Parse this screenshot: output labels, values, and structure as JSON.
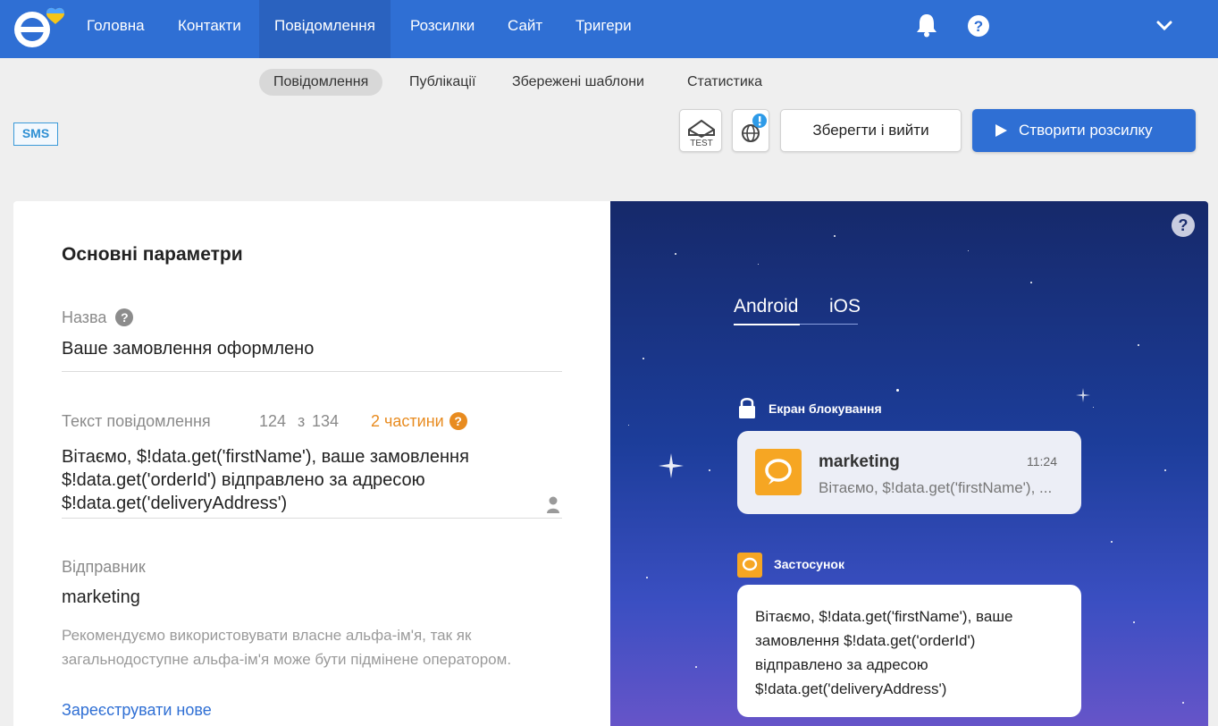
{
  "nav": {
    "items": [
      "Головна",
      "Контакти",
      "Повідомлення",
      "Розсилки",
      "Сайт",
      "Тригери"
    ],
    "active_index": 2
  },
  "subnav": {
    "tabs": [
      "Повідомлення",
      "Публікації",
      "Збережені шаблони",
      "Статистика"
    ],
    "active_index": 0
  },
  "channel_badge": "SMS",
  "toolbar": {
    "test_label": "TEST",
    "save_label": "Зберегти і вийти",
    "create_label": "Створити розсилку"
  },
  "form": {
    "title": "Основні параметри",
    "name_label": "Назва",
    "name_value": "Ваше замовлення оформлено",
    "text_label": "Текст повідомлення",
    "char_count": "124",
    "char_separator": "з",
    "char_limit": "134",
    "parts_label": "2 частини",
    "message_text": "Вітаємо, $!data.get('firstName'), ваше замовлення $!data.get('orderId') відправлено за адресою $!data.get('deliveryAddress')",
    "sender_label": "Відправник",
    "sender_value": "marketing",
    "sender_hint": "Рекомендуємо використовувати власне альфа-ім'я, так як загальнодоступне альфа-ім'я може бути підмінене оператором.",
    "register_link": "Зареєструвати нове"
  },
  "preview": {
    "tabs": [
      "Android",
      "iOS"
    ],
    "active_index": 0,
    "lock_screen_label": "Екран блокування",
    "notification": {
      "sender": "marketing",
      "time": "11:24",
      "snippet": "Вітаємо, $!data.get('firstName'), ..."
    },
    "app_label": "Застосунок",
    "app_message": "Вітаємо, $!data.get('firstName'), ваше замовлення $!data.get('orderId') відправлено за адресою $!data.get('deliveryAddress')"
  },
  "colors": {
    "brand_blue": "#2f6fd4",
    "accent_orange": "#e88b1f",
    "app_icon": "#f6a623"
  },
  "icons": [
    "logo-icon",
    "bell-icon",
    "help-icon",
    "chevron-down-icon",
    "test-mail-icon",
    "globe-icon",
    "play-icon",
    "question-icon",
    "person-icon",
    "lock-icon",
    "chat-icon"
  ]
}
